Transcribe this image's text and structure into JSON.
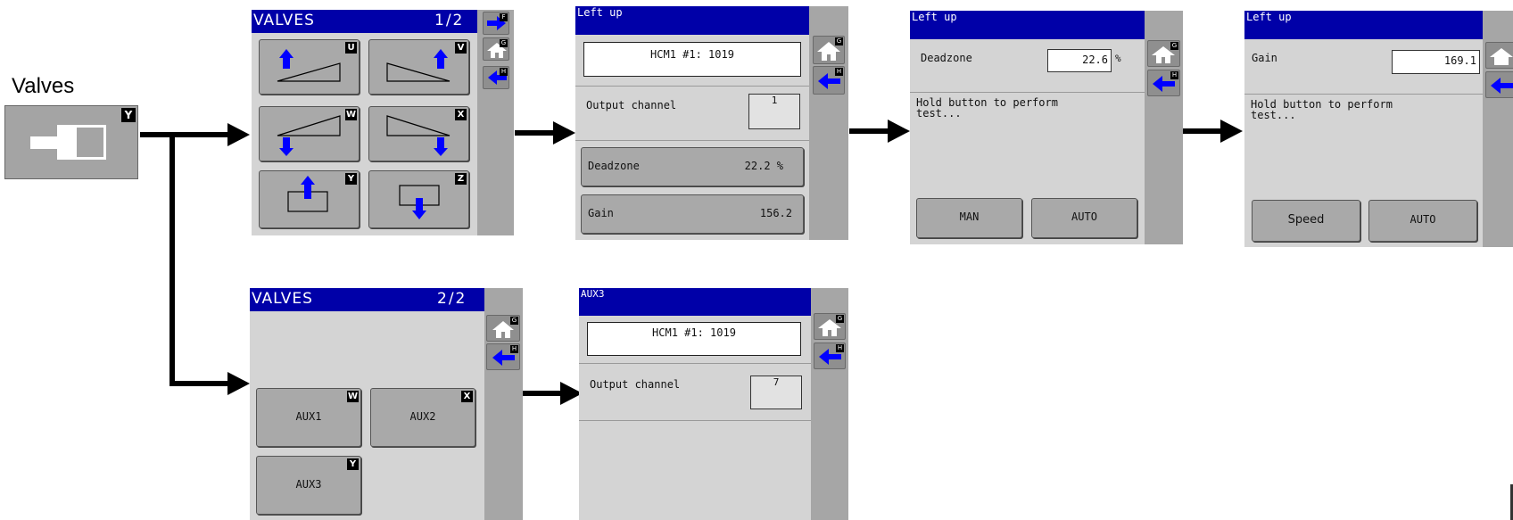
{
  "start": {
    "label": "Valves",
    "badge": "Y"
  },
  "valves_page1": {
    "title": "VALVES",
    "page": "1/2",
    "tiles": [
      {
        "badge": "U",
        "icon": "valve-ramp-up-left-icon"
      },
      {
        "badge": "V",
        "icon": "valve-ramp-up-right-icon"
      },
      {
        "badge": "W",
        "icon": "valve-ramp-down-left-icon"
      },
      {
        "badge": "X",
        "icon": "valve-ramp-down-right-icon"
      },
      {
        "badge": "Y",
        "icon": "valve-box-up-icon"
      },
      {
        "badge": "Z",
        "icon": "valve-box-down-icon"
      }
    ],
    "side_keys": [
      "F",
      "G",
      "H"
    ]
  },
  "valves_page2": {
    "title": "VALVES",
    "page": "2/2",
    "tiles": [
      {
        "label": "AUX1",
        "badge": "W"
      },
      {
        "label": "AUX2",
        "badge": "X"
      },
      {
        "label": "AUX3",
        "badge": "Y"
      }
    ],
    "side_keys": [
      "G",
      "H"
    ]
  },
  "left_up": {
    "title": "Left up",
    "id_line": "HCM1 #1: 1019",
    "output_channel": {
      "label": "Output channel",
      "value": "1"
    },
    "deadzone": {
      "label": "Deadzone",
      "value": "22.2 %"
    },
    "gain": {
      "label": "Gain",
      "value": "156.2"
    },
    "side_keys": [
      "G",
      "H"
    ]
  },
  "aux3": {
    "title": "AUX3",
    "id_line": "HCM1 #1: 1019",
    "output_channel": {
      "label": "Output channel",
      "value": "7"
    },
    "side_keys": [
      "G",
      "H"
    ]
  },
  "deadzone_screen": {
    "title": "Left up",
    "field_label": "Deadzone",
    "field_value": "22.6",
    "unit": "%",
    "message": "Hold button to perform\ntest...",
    "buttons": [
      "MAN",
      "AUTO"
    ],
    "side_keys": [
      "G",
      "H"
    ]
  },
  "gain_screen": {
    "title": "Left up",
    "field_label": "Gain",
    "field_value": "169.1",
    "message": "Hold button to perform\ntest...",
    "buttons": [
      "Speed",
      "AUTO"
    ]
  },
  "colors": {
    "title_bar": "#0000a8",
    "arrow_icon": "#0000ff",
    "screen_bg": "#d4d4d4",
    "side_bar": "#a6a6a6"
  }
}
